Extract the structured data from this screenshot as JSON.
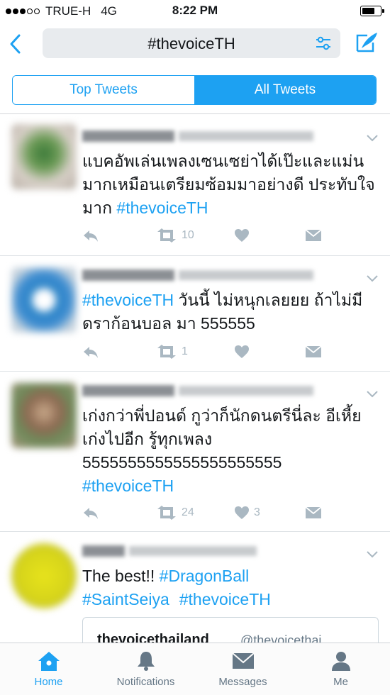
{
  "status": {
    "carrier": "TRUE-H",
    "network": "4G",
    "time": "8:22 PM"
  },
  "search": {
    "query": "#thevoiceTH"
  },
  "segment": {
    "top_label": "Top Tweets",
    "all_label": "All Tweets"
  },
  "tweets": [
    {
      "body": "แบคอัพเล่นเพลงเซนเซย่าได้เป๊ะและแม่นมากเหมือนเตรียมซ้อมมาอย่างดี ประทับใจมาก ",
      "tag": "#thevoiceTH",
      "retweets": "10",
      "likes": ""
    },
    {
      "tag": "#thevoiceTH",
      "body": " วันนี้ ไม่หนุกเลยยย ถ้าไม่มี ดราก้อนบอล มา 555555",
      "retweets": "1",
      "likes": ""
    },
    {
      "body": "เก่งกว่าพี่ปอนด์ กูว่าก็นักดนตรีนี่ละ อีเหี้ยเก่งไปอีก รู้ทุกเพลง 5555555555555555555555",
      "tag": "#thevoiceTH",
      "retweets": "24",
      "likes": "3"
    },
    {
      "body": "The best!! ",
      "tag1": "#DragonBall",
      "tag2": "#SaintSeiya",
      "tag3": "#thevoiceTH"
    }
  ],
  "quote": {
    "name": "thevoicethailand",
    "handle": "@thevoicethai"
  },
  "tabbar": {
    "home": "Home",
    "notifications": "Notifications",
    "messages": "Messages",
    "me": "Me"
  },
  "colors": {
    "accent": "#1da1f2",
    "icon_gray": "#aab8c2"
  }
}
